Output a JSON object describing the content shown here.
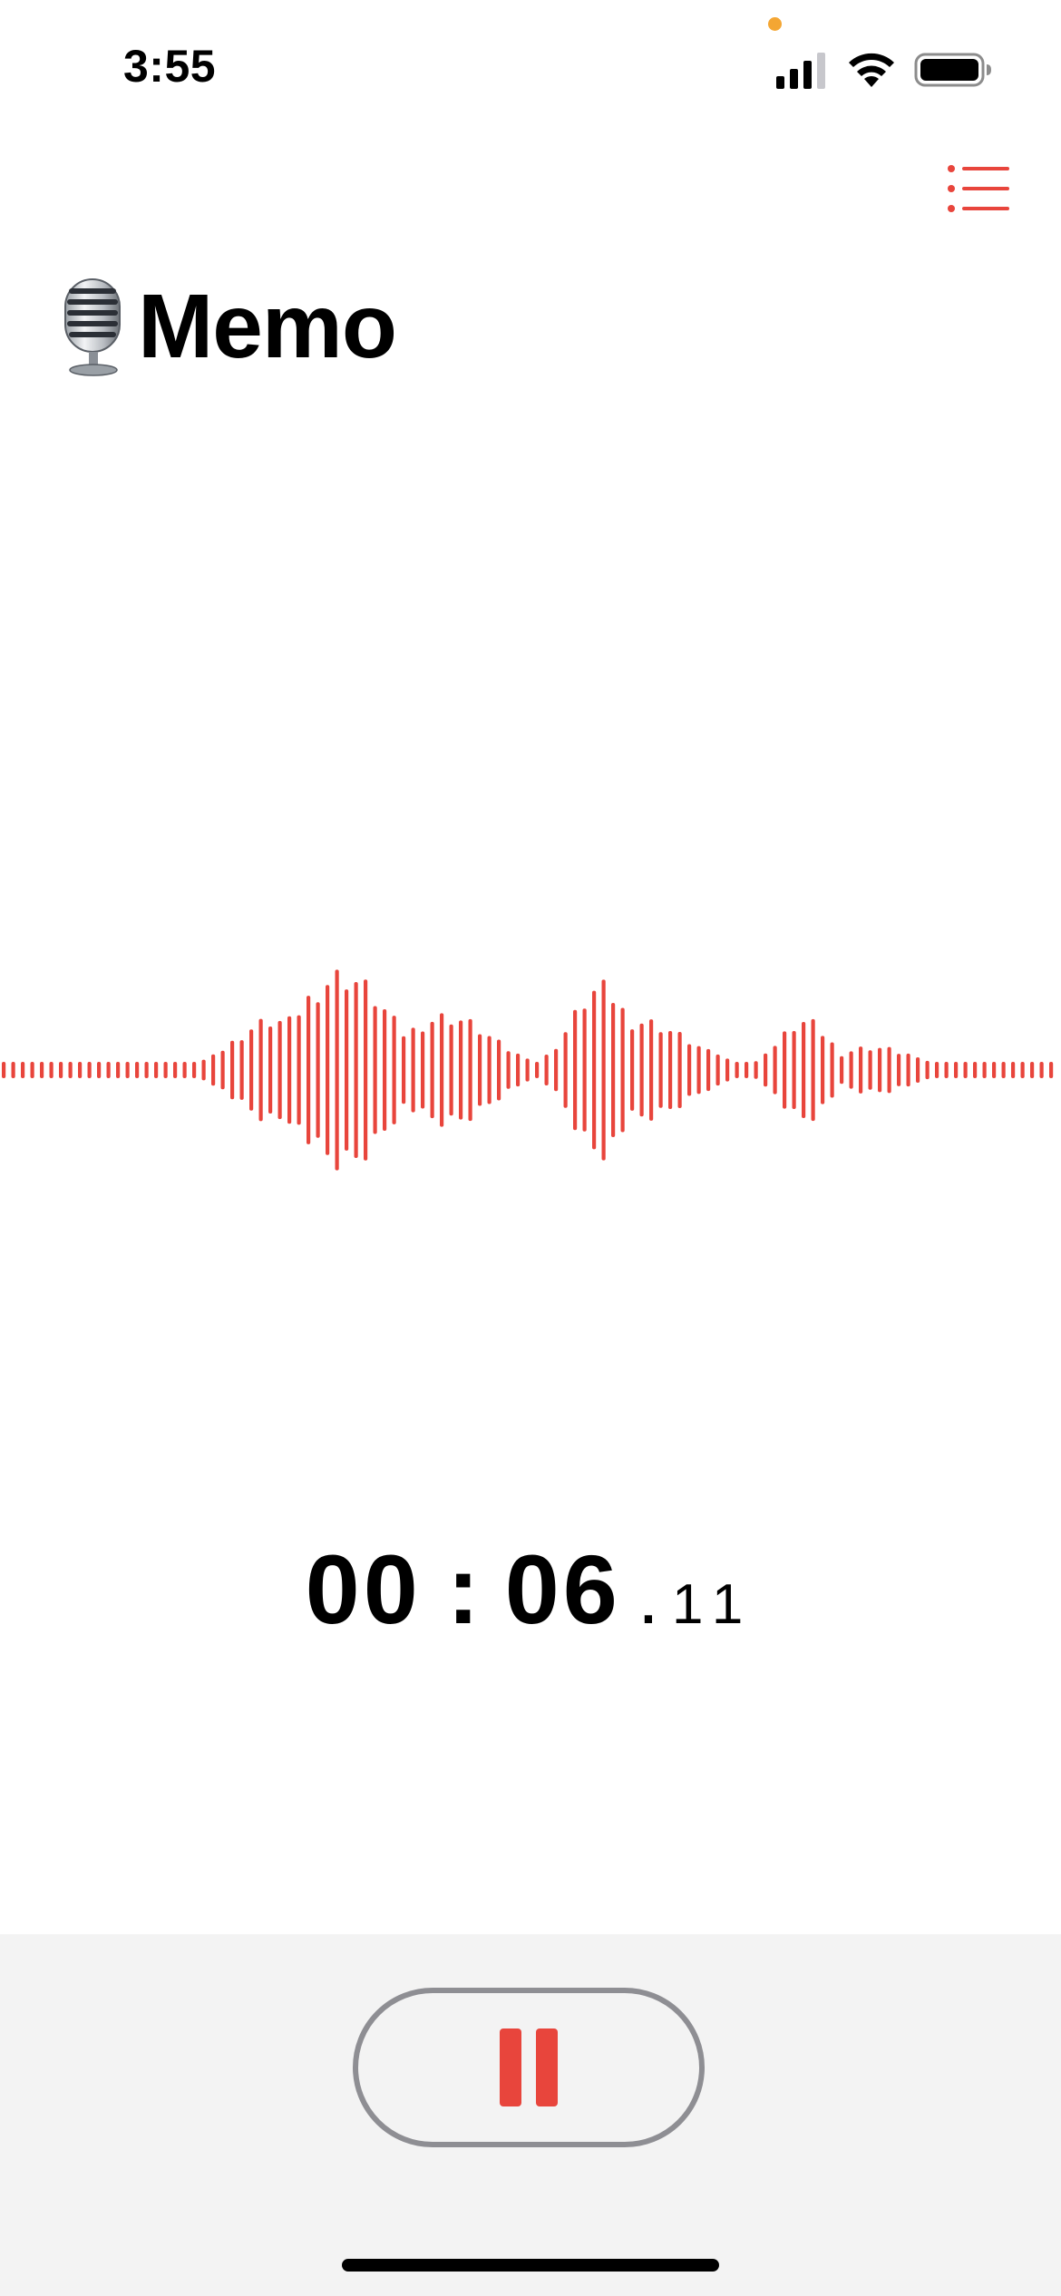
{
  "status_bar": {
    "time": "3:55",
    "icons": [
      "privacy-indicator-dot",
      "cellular-signal-icon",
      "wifi-icon",
      "battery-icon"
    ],
    "privacy_dot_color": "#F4A633"
  },
  "header": {
    "list_button_icon": "list-icon",
    "title_icon": "microphone-emoji",
    "title": "Memo"
  },
  "recorder": {
    "accent_color": "#E8453C",
    "timer": {
      "minutes": "00",
      "separator": ":",
      "seconds": "06",
      "decimal": ".",
      "fraction": "11"
    }
  },
  "controls": {
    "pause_icon": "pause-icon",
    "button_border_color": "#8E8E93",
    "panel_color": "#F3F3F3"
  }
}
